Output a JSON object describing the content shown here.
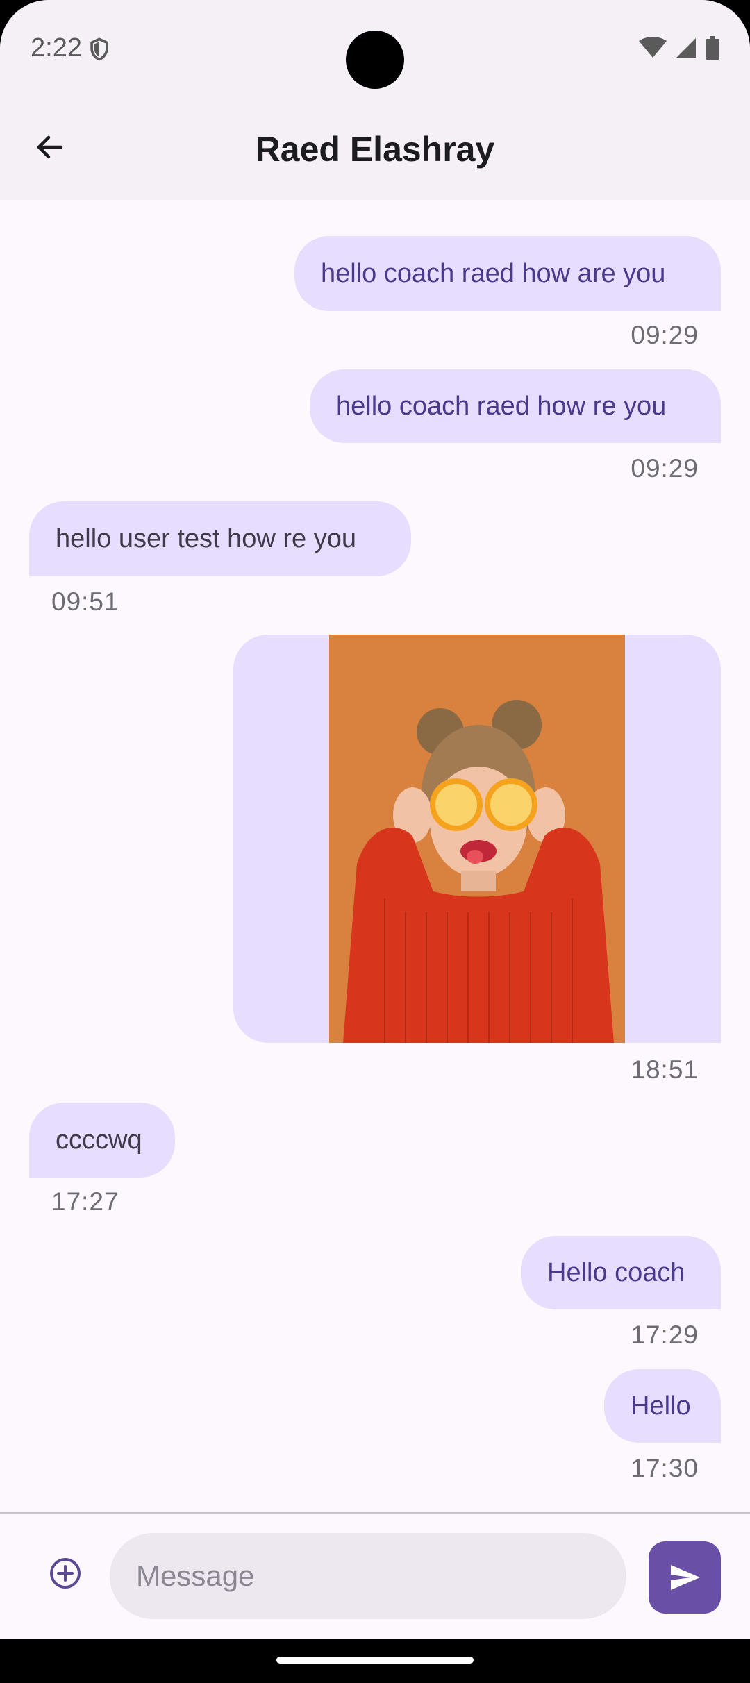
{
  "status_bar": {
    "time": "2:22"
  },
  "header": {
    "title": "Raed Elashray"
  },
  "messages": [
    {
      "text": "hello coach raed how are you",
      "time": "09:29",
      "direction": "out"
    },
    {
      "text": "hello coach raed how re you",
      "time": "09:29",
      "direction": "out"
    },
    {
      "text": "hello user test how re you",
      "time": "09:51",
      "direction": "in"
    },
    {
      "type": "image",
      "time": "18:51",
      "direction": "out"
    },
    {
      "text": "ccccwq",
      "time": "17:27",
      "direction": "in"
    },
    {
      "text": "Hello coach",
      "time": "17:29",
      "direction": "out"
    },
    {
      "text": "Hello",
      "time": "17:30",
      "direction": "out"
    }
  ],
  "composer": {
    "placeholder": "Message"
  },
  "icons": {
    "back": "arrow-back-icon",
    "attach": "add-circle-icon",
    "send": "send-icon",
    "wifi": "wifi-icon",
    "signal": "signal-icon",
    "battery": "battery-icon",
    "shield": "shield-icon"
  },
  "colors": {
    "accent": "#6a4fa6",
    "bubble": "#e7ddff",
    "background": "#fdf7fe",
    "header": "#f4f0f6"
  }
}
